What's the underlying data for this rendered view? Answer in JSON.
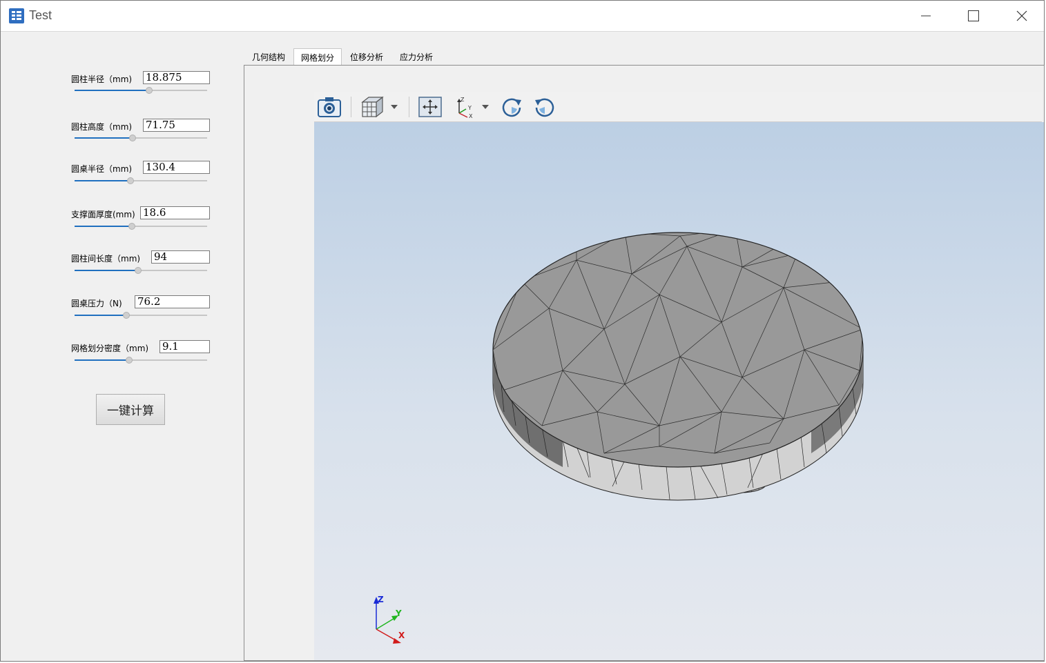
{
  "window": {
    "title": "Test"
  },
  "params": [
    {
      "label": "圆柱半径（mm)",
      "value": "18.875",
      "slider_fraction": 0.56
    },
    {
      "label": "圆柱高度（mm)",
      "value": "71.75",
      "slider_fraction": 0.44
    },
    {
      "label": "圆桌半径（mm)",
      "value": "130.4",
      "slider_fraction": 0.42
    },
    {
      "label": "支撑面厚度(mm)",
      "value": "18.6",
      "slider_fraction": 0.43
    },
    {
      "label": "圆柱间长度（mm)",
      "value": "94",
      "slider_fraction": 0.48
    },
    {
      "label": "圆桌压力（N)",
      "value": "76.2",
      "slider_fraction": 0.39
    },
    {
      "label": "网格划分密度（mm)",
      "value": "9.1",
      "slider_fraction": 0.41
    }
  ],
  "calc_button": {
    "label": "一键计算"
  },
  "tabs": [
    {
      "label": "几何结构",
      "active": false
    },
    {
      "label": "网格划分",
      "active": true
    },
    {
      "label": "位移分析",
      "active": false
    },
    {
      "label": "应力分析",
      "active": false
    }
  ],
  "toolbar": {
    "icons": [
      "camera-icon",
      "view-cube-icon",
      "chevron-down-icon",
      "fit-view-icon",
      "axis-view-icon",
      "chevron-down-icon",
      "rotate-cw-icon",
      "rotate-ccw-icon"
    ]
  },
  "axes_triad": {
    "x": "X",
    "y": "Y",
    "z": "Z"
  },
  "colors": {
    "accent": "#1f6fbf",
    "mesh_fill": "#9a9a9a",
    "mesh_side": "#d4d4d4",
    "viewport_top": "#bccfe4",
    "viewport_bottom": "#e6e9ef"
  }
}
